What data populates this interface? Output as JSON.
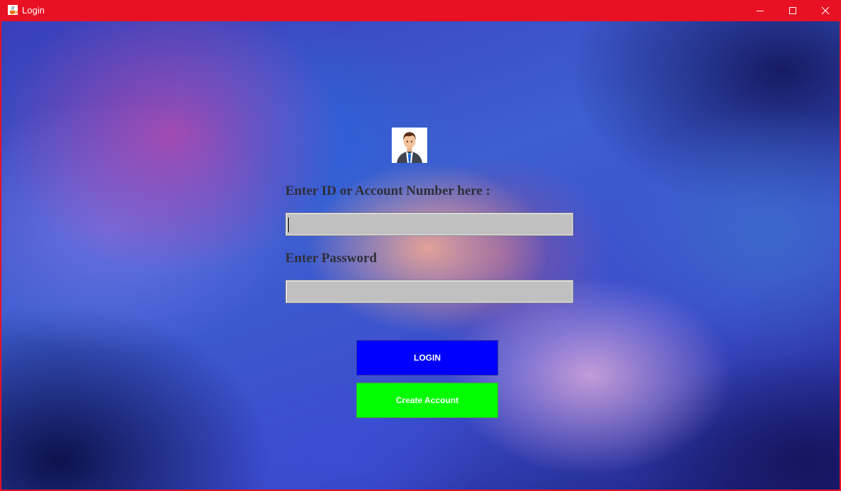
{
  "window": {
    "title": "Login",
    "app_icon": "java-cup-icon",
    "controls": {
      "minimize": "minimize-icon",
      "maximize": "maximize-icon",
      "close": "close-icon"
    }
  },
  "form": {
    "avatar_icon": "user-avatar-icon",
    "id_label": "Enter ID or Account Number here :",
    "id_value": "",
    "password_label": "Enter Password",
    "password_value": ""
  },
  "buttons": {
    "login_label": "LOGIN",
    "create_label": "Create Account"
  },
  "colors": {
    "titlebar": "#e81123",
    "login_button": "#0000ff",
    "create_button": "#00ff00",
    "field_background": "#c0c0c0"
  }
}
